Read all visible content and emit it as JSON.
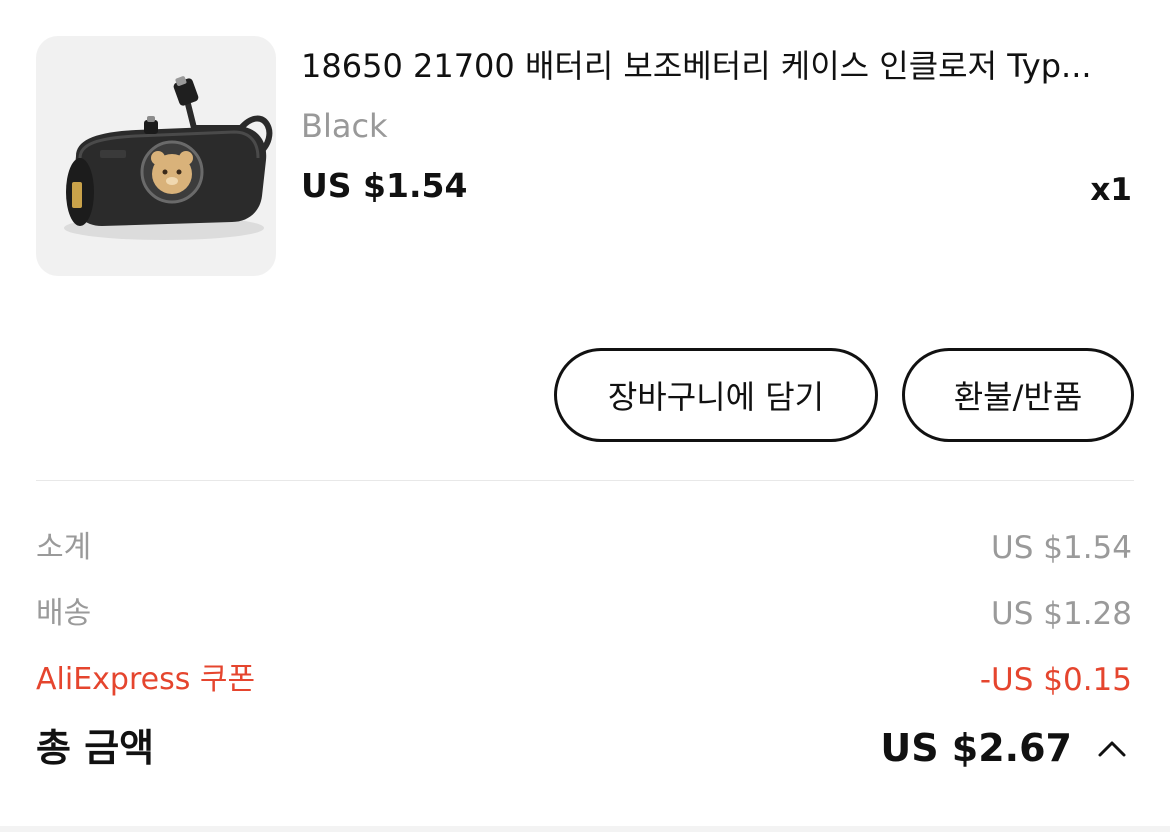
{
  "product": {
    "title": "18650 21700 배터리 보조베터리 케이스 인클로저 Typ...",
    "variant": "Black",
    "price": "US $1.54",
    "quantity": "x1",
    "image_icon": "power-bank-product-image"
  },
  "actions": {
    "add_to_cart_label": "장바구니에 담기",
    "refund_label": "환불/반품"
  },
  "summary": {
    "subtotal_label": "소계",
    "subtotal_value": "US $1.54",
    "shipping_label": "배송",
    "shipping_value": "US $1.28",
    "coupon_label": "AliExpress 쿠폰",
    "coupon_value": "-US $0.15",
    "total_label": "총 금액",
    "total_value": "US $2.67",
    "toggle_icon": "chevron-up-icon"
  },
  "colors": {
    "text": "#111111",
    "muted": "#999999",
    "accent_red": "#e5452e",
    "thumb_bg": "#f1f1f1"
  }
}
